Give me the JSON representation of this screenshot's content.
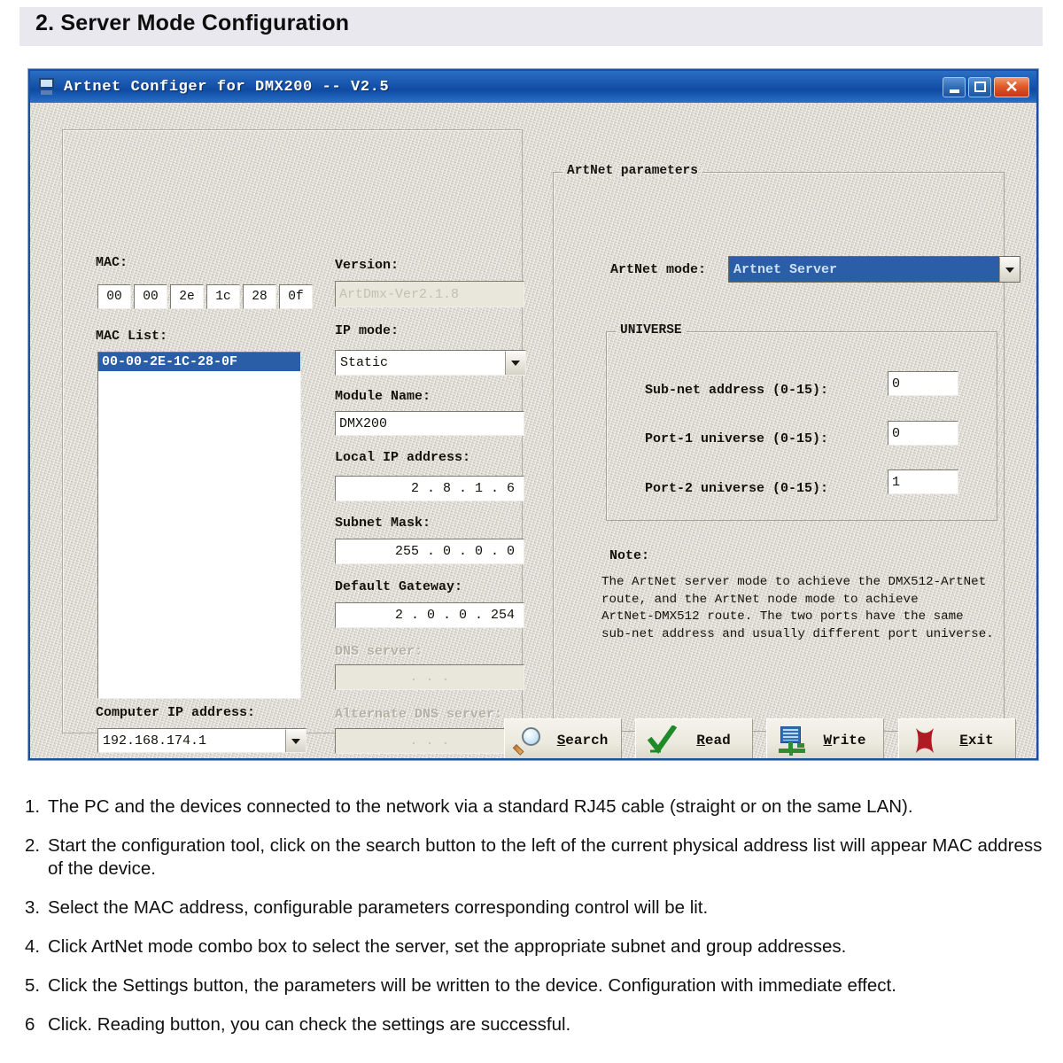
{
  "section": {
    "heading": "2. Server Mode Configuration"
  },
  "window": {
    "title": "Artnet Configer for DMX200 -- V2.5",
    "icon": "computer-icon",
    "buttons": {
      "minimize": "minimize-button",
      "maximize": "maximize-button",
      "close": "close-button"
    }
  },
  "left_panel": {
    "mac": {
      "label": "MAC:",
      "octets": [
        "00",
        "00",
        "2e",
        "1c",
        "28",
        "0f"
      ]
    },
    "mac_list": {
      "label": "MAC List:",
      "items": [
        "00-00-2E-1C-28-0F"
      ],
      "selected_index": 0
    },
    "computer_ip": {
      "label": "Computer IP address:",
      "value": "192.168.174.1"
    },
    "version": {
      "label": "Version:",
      "value": "ArtDmx-Ver2.1.8",
      "enabled": false
    },
    "ip_mode": {
      "label": "IP mode:",
      "value": "Static"
    },
    "module_name": {
      "label": "Module Name:",
      "value": "DMX200"
    },
    "local_ip": {
      "label": "Local IP address:",
      "value": "2  .  8  .  1  .  6"
    },
    "subnet_mask": {
      "label": "Subnet Mask:",
      "value": "255 .  0  .  0  .  0"
    },
    "default_gateway": {
      "label": "Default Gateway:",
      "value": "2  .  0  .  0  . 254"
    },
    "dns_server": {
      "label": "DNS server:",
      "value": ".     .     .",
      "enabled": false
    },
    "alt_dns_server": {
      "label": "Alternate DNS server:",
      "value": ".     .     .",
      "enabled": false
    }
  },
  "right_panel": {
    "group_title": "ArtNet parameters",
    "artnet_mode": {
      "label": "ArtNet mode:",
      "value": "Artnet Server",
      "selected": true
    },
    "universe": {
      "group_title": "UNIVERSE",
      "rows": [
        {
          "label": "Sub-net address (0-15):",
          "value": "0"
        },
        {
          "label": "Port-1 universe (0-15):",
          "value": "0"
        },
        {
          "label": "Port-2 universe (0-15):",
          "value": "1"
        }
      ]
    },
    "note": {
      "title": "Note:",
      "body": "The ArtNet server mode to achieve the DMX512-ArtNet\nroute, and the ArtNet node mode to achieve\nArtNet-DMX512 route. The two ports have the same\nsub-net address and usually different port universe."
    }
  },
  "buttons": [
    {
      "name": "search",
      "label_pre": "",
      "accel": "S",
      "label_post": "earch",
      "icon": "magnifier-icon"
    },
    {
      "name": "read",
      "label_pre": "",
      "accel": "R",
      "label_post": "ead",
      "icon": "green-check-icon"
    },
    {
      "name": "write",
      "label_pre": "",
      "accel": "W",
      "label_post": "rite",
      "icon": "write-device-icon"
    },
    {
      "name": "exit",
      "label_pre": "",
      "accel": "E",
      "label_post": "xit",
      "icon": "red-x-icon"
    }
  ],
  "instructions": [
    {
      "num": "1.",
      "text": "The PC and the devices connected to the network via a standard RJ45 cable (straight or on the same LAN)."
    },
    {
      "num": "2.",
      "text": "Start the configuration tool, click on the search button to the left of the current physical address list will appear MAC address of the device."
    },
    {
      "num": "3.",
      "text": "Select the MAC address, configurable parameters corresponding control will be lit."
    },
    {
      "num": "4.",
      "text": "Click  ArtNet mode combo box to select the server, set the appropriate subnet and group addresses."
    },
    {
      "num": "5.",
      "text": "Click the Settings button, the parameters will be written to the device. Configuration with immediate effect."
    },
    {
      "num": "6",
      "text": "Click. Reading button, you can check the settings are successful."
    }
  ],
  "colors": {
    "titlebar_blue": "#1a57ae",
    "selection_blue": "#2a5fa8",
    "client_bg": "#dedbd3",
    "close_red": "#c43812"
  }
}
